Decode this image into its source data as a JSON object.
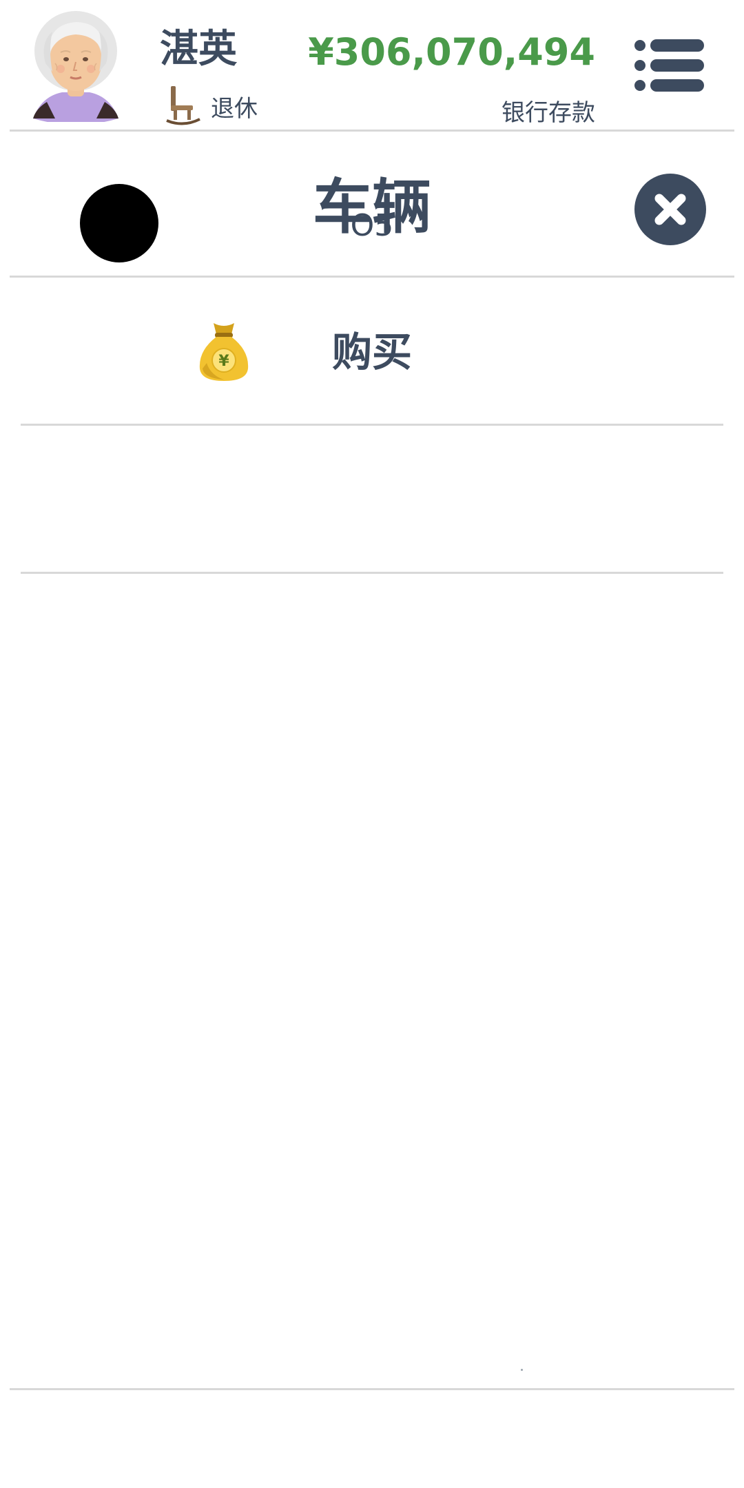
{
  "header": {
    "player_name": "湛英",
    "status_icon": "rocking-chair-icon",
    "status_label": "退休",
    "money": "¥306,070,494",
    "money_label": "银行存款",
    "money_color": "#4a9a4a",
    "menu_icon": "list-menu-icon"
  },
  "page": {
    "title": "车辆",
    "close_icon": "close-icon",
    "accent_color": "#3d4b5f"
  },
  "list": {
    "buy": {
      "icon": "money-bag-icon",
      "label": "购买"
    },
    "vehicles": [
      {
        "icon": "black-circle-icon",
        "label": "O5"
      }
    ]
  }
}
